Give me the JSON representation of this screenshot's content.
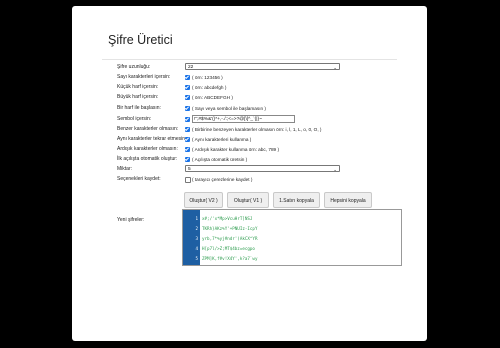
{
  "title": "Şifre Üretici",
  "form": {
    "length": {
      "label": "Şifre uzunluğu:",
      "value": "22"
    },
    "numbers": {
      "label": "Sayı karakterleri içersin:",
      "desc": "( örn: 123456 )",
      "checked": true
    },
    "lowercase": {
      "label": "Küçük harf içersin:",
      "desc": "( örn: abcdefgh )",
      "checked": true
    },
    "uppercase": {
      "label": "Büyük harf içersin:",
      "desc": "( örn: ABCDEFGH )",
      "checked": true
    },
    "start_with_letter": {
      "label": "Bir harf ile başlasın:",
      "desc": "( Sayı veya sembol ile başlamasın )",
      "checked": true
    },
    "symbols": {
      "label": "Sembol içersin:",
      "value": "!\";#$%&'()*+,-./:;<=>?@[\\]^_`{|}~",
      "checked": true
    },
    "similar": {
      "label": "Benzer karakterler olmasın:",
      "desc": "( Birbirine benzeyen karakterler olmasın örn: i, l, 1, L, o, 0, O, )",
      "checked": true
    },
    "no_repeat": {
      "label": "Aynı karakterler tekrar etmesin:",
      "desc": "( Aynı karakterleri kullanma )",
      "checked": true
    },
    "no_sequential": {
      "label": "Ardışık karakterler olmasın:",
      "desc": "( Ardışık karakter kullanma örn: abc, 789 )",
      "checked": true
    },
    "auto_generate": {
      "label": "İlk açılışta otomatik oluştur:",
      "desc": "( Açılışta otomatik üretsin )",
      "checked": true
    },
    "count": {
      "label": "Miktar:",
      "value": "5"
    },
    "save_settings": {
      "label": "Seçenekleri kaydet:",
      "desc": "( tarayıcı çerezlerine kaydet )",
      "checked": false
    }
  },
  "buttons": {
    "generate_v2": "Oluştur( V2 )",
    "generate_v1": "Oluştur( V1 )",
    "copy_first": "1.Satırı kopyala",
    "copy_all": "Hepsini kopyala"
  },
  "output": {
    "label": "Yeni şifreler:",
    "lines": [
      {
        "n": "1",
        "text": "x#;/'x*Mp>VcuHrT]NSJ"
      },
      {
        "n": "2",
        "text": "TKRh}AKz%Y'+PNUIz-IcpY"
      },
      {
        "n": "3",
        "text": "yrb,7*%yj#ndr'(AkCX^YR"
      },
      {
        "n": "4",
        "text": "H[p7l/>Z;MT$4bz=ecgpo"
      },
      {
        "n": "5",
        "text": "ZPM]K,f#v!X4Y',k?a7`wy"
      }
    ]
  },
  "colors": {
    "checkbox": "#1a73e8",
    "gutter": "#1e5fa3",
    "code_text": "#2e9d4f"
  }
}
